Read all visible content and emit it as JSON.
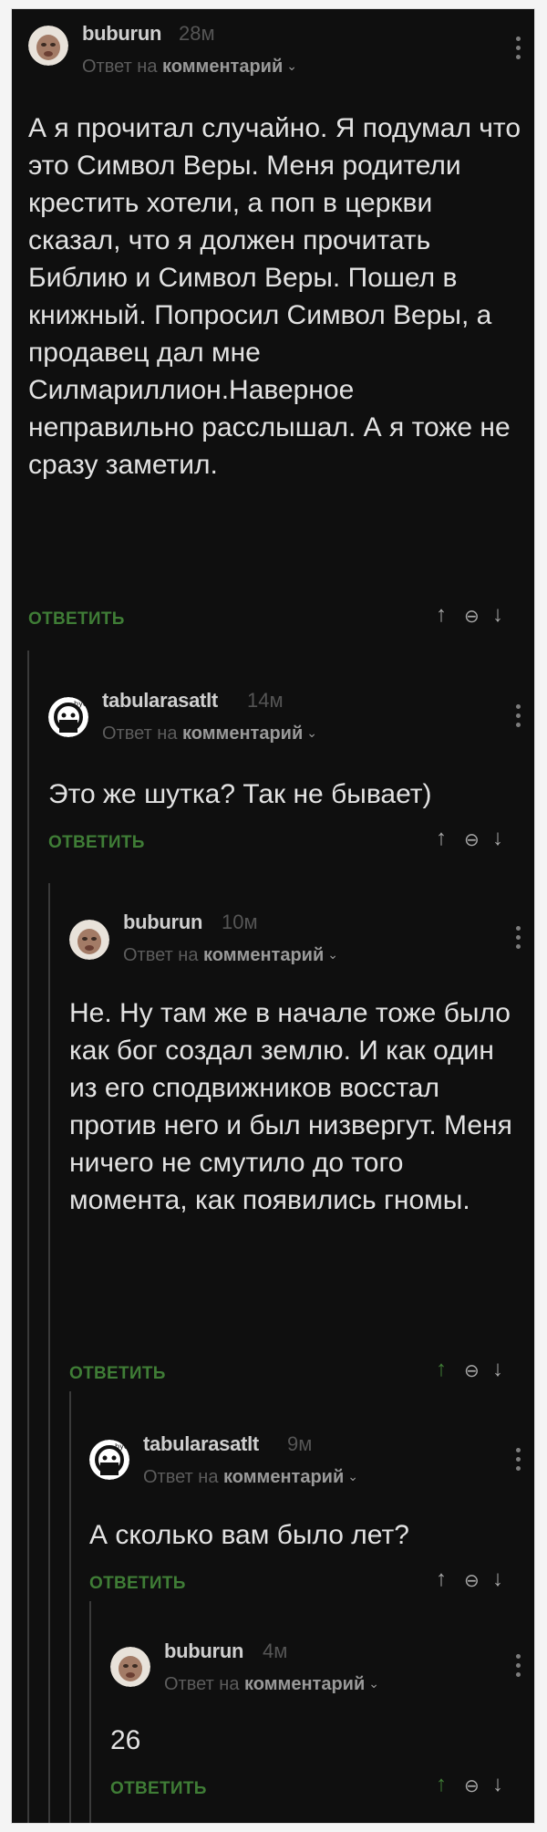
{
  "reply_prefix": "Ответ на",
  "reply_target": "комментарий",
  "reply_label": "ОТВЕТИТЬ",
  "comments": [
    {
      "user": "buburun",
      "time": "28м",
      "text": "А я прочитал случайно. Я подумал что это Символ Веры. Меня родители крестить хотели, а поп в церкви сказал, что я должен прочитать Библию и Символ Веры. Пошел в книжный. Попросил Символ Веры, а продавец дал мне Силмариллион.Наверное неправильно расслышал. А я тоже не сразу заметил."
    },
    {
      "user": "tabularasatlt",
      "time": "14м",
      "text": "Это же шутка? Так не бывает)"
    },
    {
      "user": "buburun",
      "time": "10м",
      "text": "Не. Ну там же в начале тоже было как бог создал землю. И как один из его сподвижников восстал против него и был низвергут. Меня ничего не смутило до того момента, как появились гномы."
    },
    {
      "user": "tabularasatlt",
      "time": "9м",
      "text": "А сколько вам было лет?"
    },
    {
      "user": "buburun",
      "time": "4м",
      "text": "26"
    }
  ],
  "icons": {
    "up": "arrow-up-icon",
    "save": "bookmark-icon",
    "down": "arrow-down-icon"
  },
  "colors": {
    "background": "#0f0f0f",
    "reply_green": "#3f7d36",
    "text": "#e2e2e2"
  }
}
